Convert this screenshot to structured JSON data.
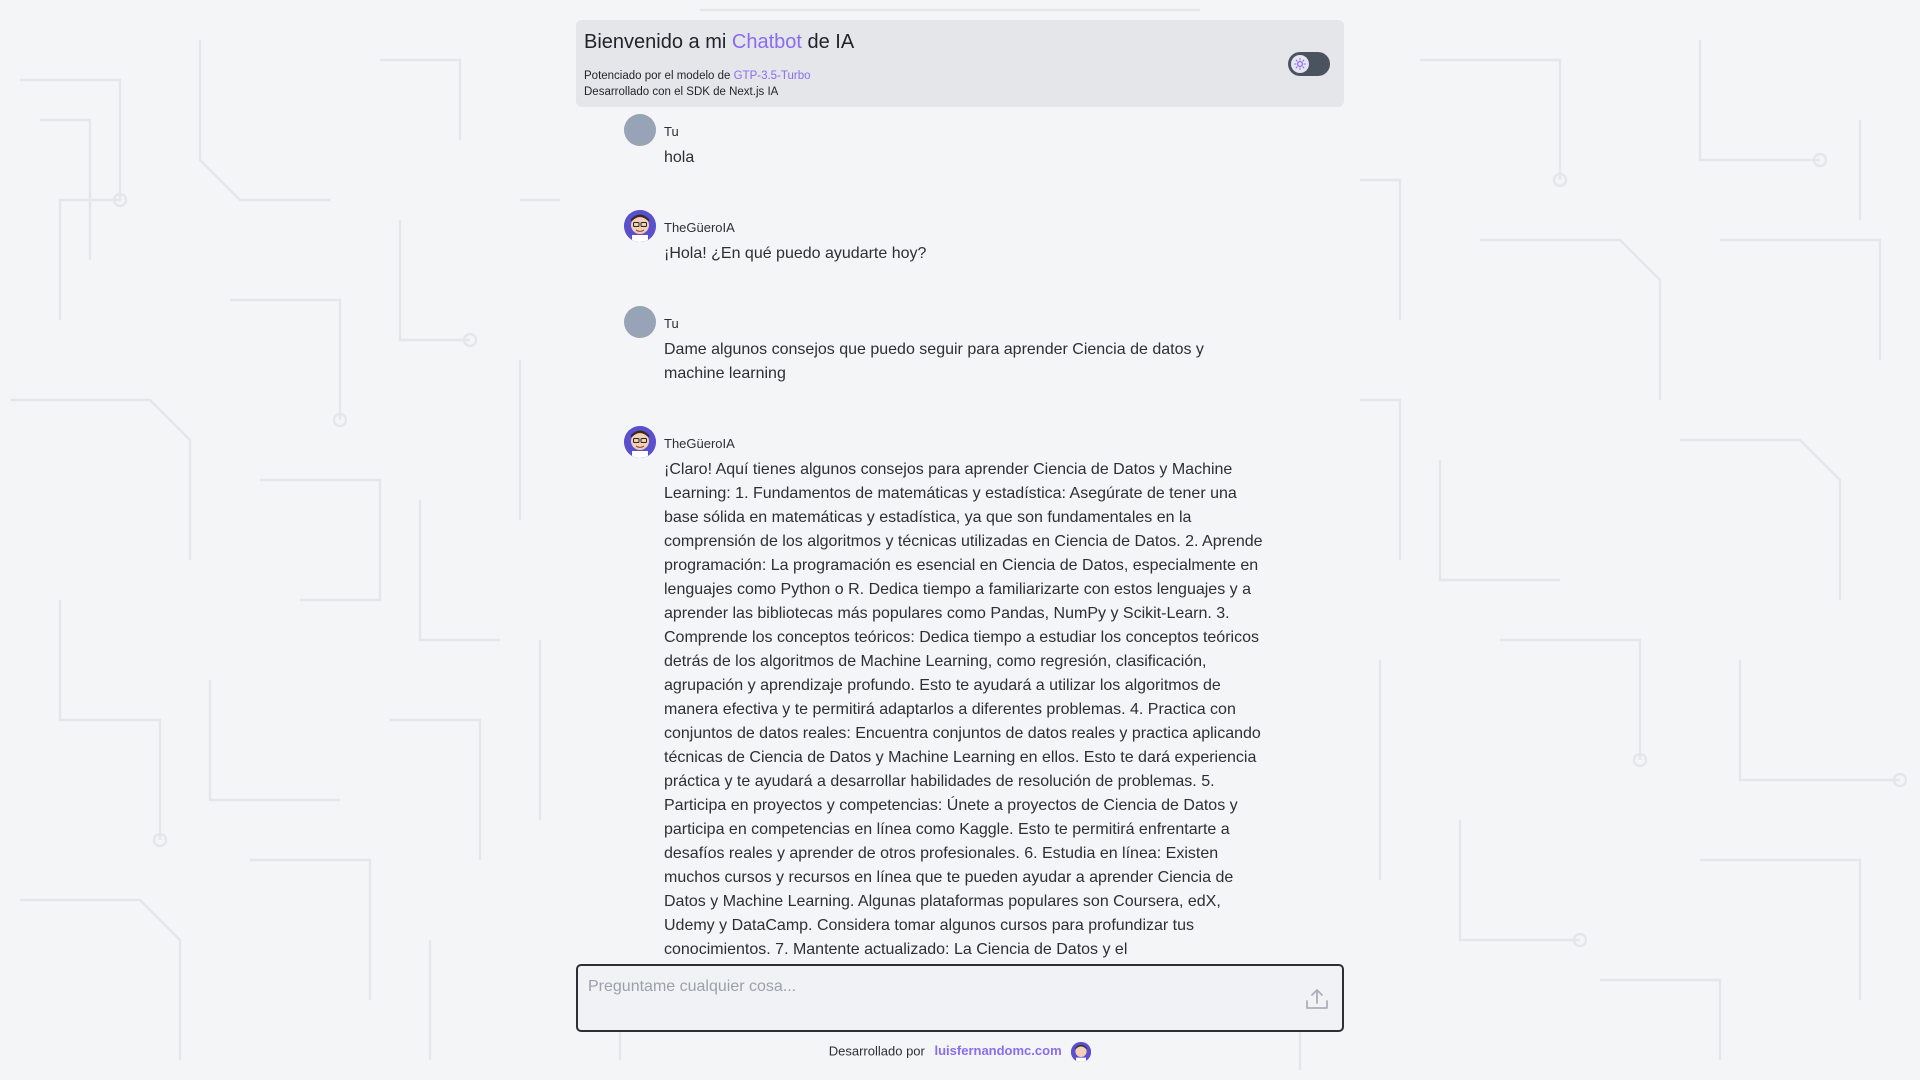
{
  "header": {
    "title_pre": "Bienvenido a mi ",
    "title_accent": "Chatbot",
    "title_post": " de IA",
    "powered_pre": "Potenciado por el modelo de ",
    "powered_model": "GTP-3.5-Turbo",
    "built_with": "Desarrollado con el SDK de Next.js IA",
    "theme_toggle_icon": "sun-icon"
  },
  "messages": [
    {
      "author": "Tu",
      "role": "user",
      "text": "hola"
    },
    {
      "author": "TheGüeroIA",
      "role": "assistant",
      "text": "¡Hola! ¿En qué puedo ayudarte hoy?"
    },
    {
      "author": "Tu",
      "role": "user",
      "text": "Dame algunos consejos que puedo seguir para aprender Ciencia de datos y machine learning"
    },
    {
      "author": "TheGüeroIA",
      "role": "assistant",
      "text": "¡Claro! Aquí tienes algunos consejos para aprender Ciencia de Datos y Machine Learning: 1. Fundamentos de matemáticas y estadística: Asegúrate de tener una base sólida en matemáticas y estadística, ya que son fundamentales en la comprensión de los algoritmos y técnicas utilizadas en Ciencia de Datos. 2. Aprende programación: La programación es esencial en Ciencia de Datos, especialmente en lenguajes como Python o R. Dedica tiempo a familiarizarte con estos lenguajes y a aprender las bibliotecas más populares como Pandas, NumPy y Scikit-Learn. 3. Comprende los conceptos teóricos: Dedica tiempo a estudiar los conceptos teóricos detrás de los algoritmos de Machine Learning, como regresión, clasificación, agrupación y aprendizaje profundo. Esto te ayudará a utilizar los algoritmos de manera efectiva y te permitirá adaptarlos a diferentes problemas. 4. Practica con conjuntos de datos reales: Encuentra conjuntos de datos reales y practica aplicando técnicas de Ciencia de Datos y Machine Learning en ellos. Esto te dará experiencia práctica y te ayudará a desarrollar habilidades de resolución de problemas. 5. Participa en proyectos y competencias: Únete a proyectos de Ciencia de Datos y participa en competencias en línea como Kaggle. Esto te permitirá enfrentarte a desafíos reales y aprender de otros profesionales. 6. Estudia en línea: Existen muchos cursos y recursos en línea que te pueden ayudar a aprender Ciencia de Datos y Machine Learning. Algunas plataformas populares son Coursera, edX, Udemy y DataCamp. Considera tomar algunos cursos para profundizar tus conocimientos. 7. Mantente actualizado: La Ciencia de Datos y el"
    }
  ],
  "composer": {
    "placeholder": "Preguntame cualquier cosa...",
    "value": "",
    "send_icon": "upload-arrow-icon"
  },
  "footer": {
    "label": "Desarrollado por",
    "site": "luisfernandomc.com"
  },
  "colors": {
    "accent": "#8b6cf0",
    "background": "#f4f5f7",
    "header_bg": "#e4e6ea",
    "user_avatar": "#97a3b6"
  }
}
